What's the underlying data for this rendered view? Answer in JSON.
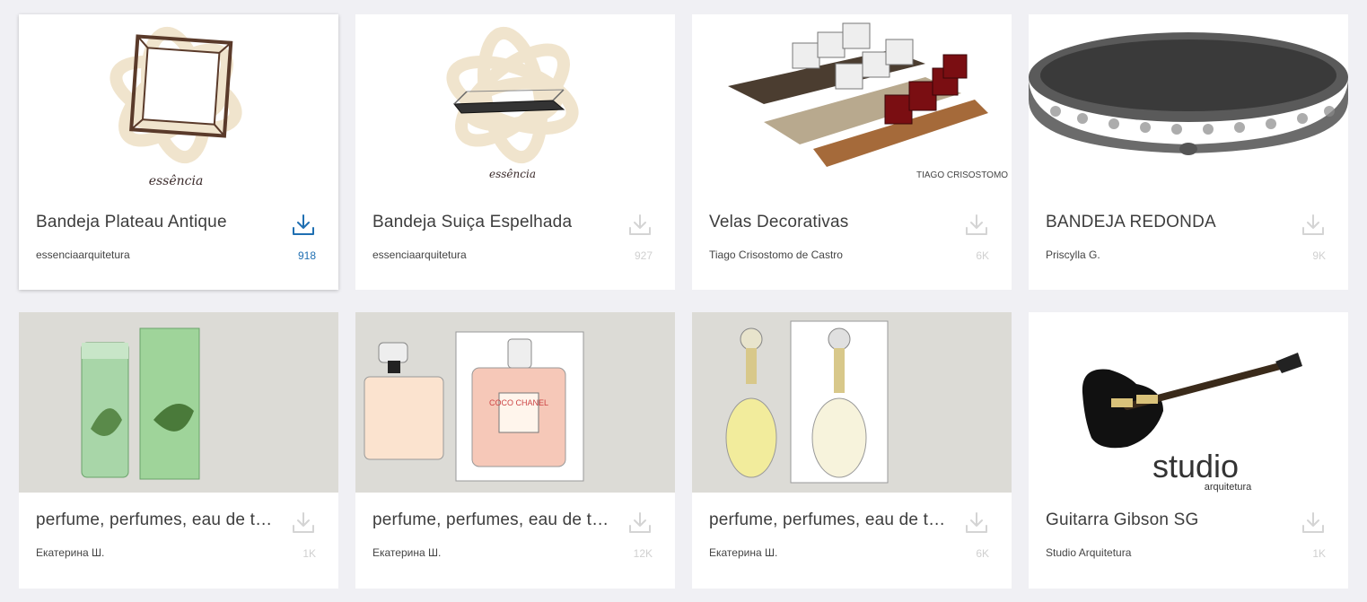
{
  "cards": [
    {
      "title": "Bandeja Plateau Antique",
      "author": "essenciaarquitetura",
      "count": "918",
      "thumb_caption": "essência"
    },
    {
      "title": "Bandeja Suiça Espelhada",
      "author": "essenciaarquitetura",
      "count": "927",
      "thumb_caption": "essência"
    },
    {
      "title": "Velas Decorativas",
      "author": "Tiago Crisostomo de Castro",
      "count": "6K",
      "thumb_caption": "TIAGO CRISOSTOMO"
    },
    {
      "title": "BANDEJA REDONDA",
      "author": "Priscylla G.",
      "count": "9K"
    },
    {
      "title": "perfume, perfumes, eau de toilette",
      "author": "Екатерина Ш.",
      "count": "1K"
    },
    {
      "title": "perfume, perfumes, eau de toilette",
      "author": "Екатерина Ш.",
      "count": "12K",
      "thumb_caption": "COCO CHANEL"
    },
    {
      "title": "perfume, perfumes, eau de toilette",
      "author": "Екатерина Ш.",
      "count": "6K"
    },
    {
      "title": "Guitarra Gibson SG",
      "author": "Studio Arquitetura",
      "count": "1K",
      "thumb_caption": "studio",
      "thumb_sub": "arquitetura"
    }
  ],
  "colors": {
    "accent": "#1f6fb2",
    "muted_icon": "#d4d4d4",
    "background": "#f0f0f4"
  },
  "icons": {
    "download": "download-icon"
  }
}
